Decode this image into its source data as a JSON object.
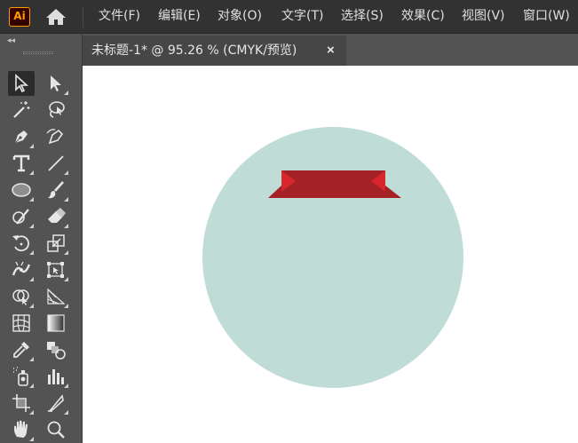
{
  "app": {
    "logo_text": "Ai",
    "logo_color": "#ff9a00"
  },
  "menu": {
    "items": [
      "文件(F)",
      "编辑(E)",
      "对象(O)",
      "文字(T)",
      "选择(S)",
      "效果(C)",
      "视图(V)",
      "窗口(W)"
    ]
  },
  "document": {
    "tab_label": "未标题-1* @ 95.26 % (CMYK/预览)",
    "close_label": "×"
  },
  "artwork": {
    "circle_color": "#bfddd6",
    "ribbon_color": "#a42226",
    "ribbon_fold_color": "#d7262c"
  },
  "tools": [
    "selection-tool",
    "direct-selection-tool",
    "magic-wand-tool",
    "lasso-tool",
    "pen-tool",
    "curvature-tool",
    "type-tool",
    "line-segment-tool",
    "ellipse-tool",
    "paintbrush-tool",
    "shaper-tool",
    "eraser-tool",
    "rotate-tool",
    "scale-tool",
    "puppet-warp-tool",
    "free-transform-tool",
    "shape-builder-tool",
    "perspective-grid-tool",
    "mesh-tool",
    "gradient-tool",
    "eyedropper-tool",
    "blend-tool",
    "symbol-sprayer-tool",
    "column-graph-tool",
    "artboard-tool",
    "slice-tool",
    "hand-tool",
    "zoom-tool"
  ]
}
